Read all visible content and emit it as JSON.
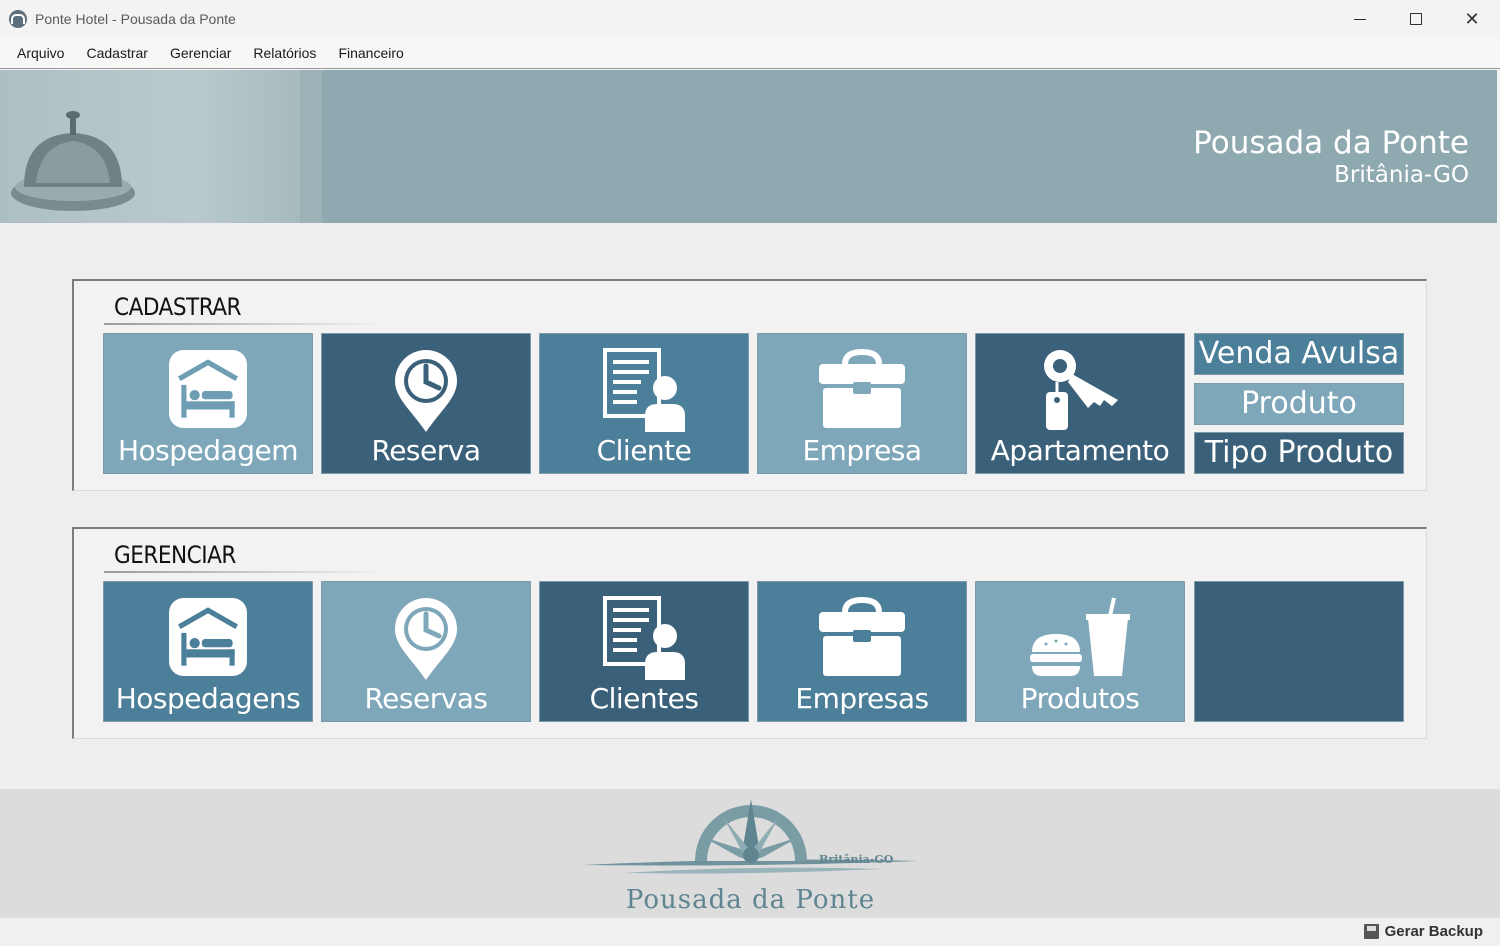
{
  "window": {
    "title": "Ponte Hotel - Pousada da Ponte",
    "minimize_glyph": "",
    "close_glyph": "✕"
  },
  "menu": [
    "Arquivo",
    "Cadastrar",
    "Gerenciar",
    "Relatórios",
    "Financeiro"
  ],
  "banner": {
    "title": "Pousada da Ponte",
    "subtitle": "Britânia-GO"
  },
  "cadastrar": {
    "title": "CADASTRAR",
    "tiles": [
      {
        "label": "Hospedagem",
        "icon": "bed-icon"
      },
      {
        "label": "Reserva",
        "icon": "clock-pin-icon"
      },
      {
        "label": "Cliente",
        "icon": "document-user-icon"
      },
      {
        "label": "Empresa",
        "icon": "briefcase-icon"
      },
      {
        "label": "Apartamento",
        "icon": "key-icon"
      }
    ],
    "small_tiles": [
      "Venda Avulsa",
      "Produto",
      "Tipo Produto"
    ]
  },
  "gerenciar": {
    "title": "GERENCIAR",
    "tiles": [
      {
        "label": "Hospedagens",
        "icon": "bed-icon"
      },
      {
        "label": "Reservas",
        "icon": "clock-pin-icon"
      },
      {
        "label": "Clientes",
        "icon": "document-user-icon"
      },
      {
        "label": "Empresas",
        "icon": "briefcase-icon"
      },
      {
        "label": "Produtos",
        "icon": "burger-drink-icon"
      },
      {
        "label": "",
        "icon": ""
      }
    ]
  },
  "footer": {
    "logo_text": "Pousada da Ponte",
    "logo_sub": "Britânia-GO"
  },
  "status": {
    "backup_label": "Gerar Backup"
  },
  "colors": {
    "tile_light": "#6f9db4",
    "tile_mid": "#4c7f99",
    "tile_dark": "#3a6179",
    "banner": "#8fa9b0"
  }
}
